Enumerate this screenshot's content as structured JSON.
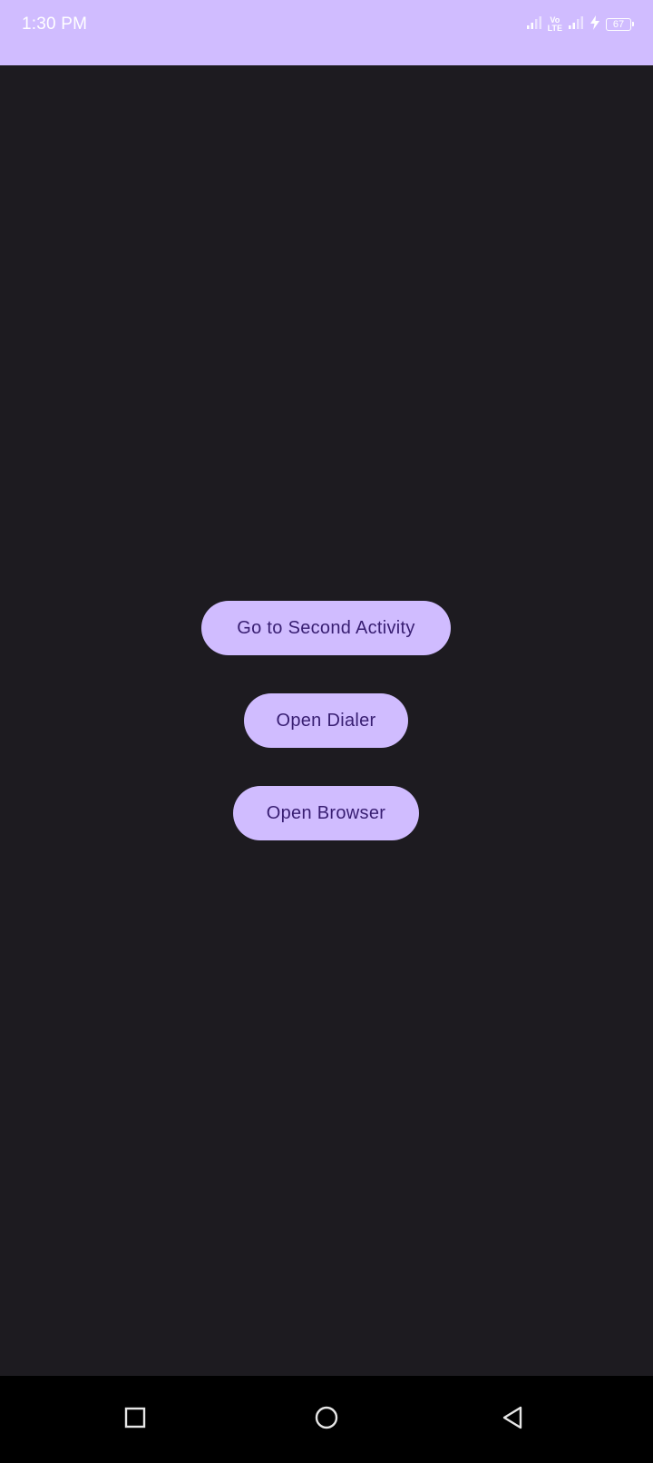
{
  "status_bar": {
    "time": "1:30 PM",
    "volte_top": "Vo",
    "volte_bottom": "LTE",
    "battery_level": "67",
    "background_color": "#d0bcff",
    "icons": [
      "signal-icon",
      "volte-icon",
      "signal-icon",
      "charging-icon",
      "battery-icon"
    ]
  },
  "main": {
    "background_color": "#1d1b20",
    "buttons": [
      {
        "label": "Go to Second Activity"
      },
      {
        "label": "Open Dialer"
      },
      {
        "label": "Open Browser"
      }
    ],
    "button_color": "#d0bcff",
    "button_text_color": "#381e72"
  },
  "nav_bar": {
    "background_color": "#000000",
    "icons": [
      "recents-square-icon",
      "home-circle-icon",
      "back-triangle-icon"
    ]
  }
}
